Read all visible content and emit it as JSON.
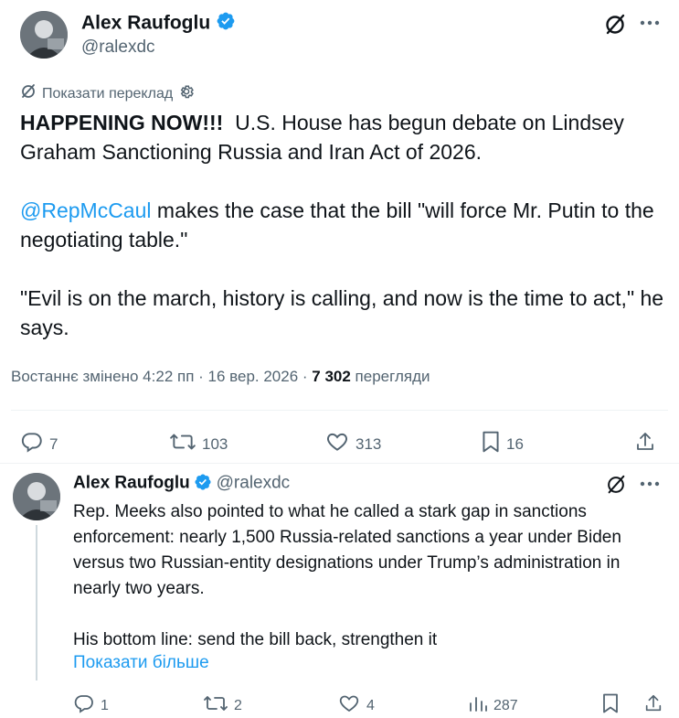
{
  "main_tweet": {
    "author_name": "Alex Raufoglu",
    "author_handle": "@ralexdc",
    "translate_label": "Показати переклад",
    "text_bold": "HAPPENING NOW!!!",
    "text_line1_rest": "  U.S. House has begun debate on Lindsey Graham Sanctioning Russia and Iran Act of 2026.",
    "mention": "@RepMcCaul",
    "text_para2_rest": " makes the case that the bill \"will force Mr. Putin to the negotiating table.\"",
    "text_para3": "\"Evil is on the march, history is calling, and now is the time to act,\" he says.",
    "meta_prefix": "Востаннє змінено 4:22 пп · 16 вер. 2026 · ",
    "views_count": "7 302",
    "views_label": " перегляди",
    "actions": {
      "replies": "7",
      "reposts": "103",
      "likes": "313",
      "bookmarks": "16"
    }
  },
  "reply_tweet": {
    "author_name": "Alex Raufoglu",
    "author_handle": "@ralexdc",
    "text_para1": "Rep. Meeks also pointed to what he called a stark gap in sanctions enforcement: nearly 1,500 Russia-related sanctions a year under Biden versus two Russian-entity designations under Trump’s administration in nearly two years.",
    "text_para2": "His bottom line: send the bill back, strengthen it",
    "show_more": "Показати більше",
    "actions": {
      "replies": "1",
      "reposts": "2",
      "likes": "4",
      "views": "287"
    }
  },
  "colors": {
    "accent": "#1d9bf0",
    "text_primary": "#0f1419",
    "text_secondary": "#536471"
  }
}
